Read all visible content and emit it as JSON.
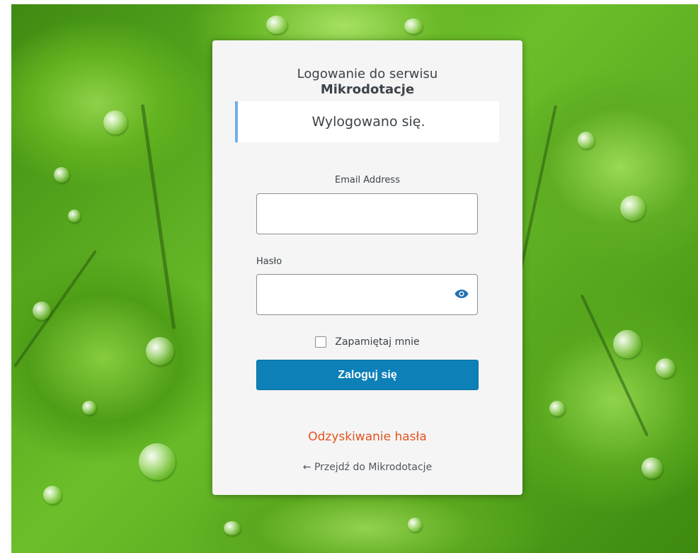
{
  "login": {
    "heading_line1": "Logowanie do serwisu",
    "heading_line2": "Mikrodotacje",
    "notice": "Wylogowano się.",
    "email_label": "Email Address",
    "email_value": "",
    "password_label": "Hasło",
    "password_value": "",
    "show_password_icon": "eye-icon",
    "remember_label": "Zapamiętaj mnie",
    "remember_checked": false,
    "submit_label": "Zaloguj się",
    "lost_password_link": "Odzyskiwanie hasła",
    "back_link": "← Przejdź do Mikrodotacje"
  },
  "colors": {
    "primary_button": "#0d80b8",
    "notice_border": "#72aee6",
    "lost_password_link": "#e6521f",
    "background_theme": "green clover leaves with water drops"
  }
}
